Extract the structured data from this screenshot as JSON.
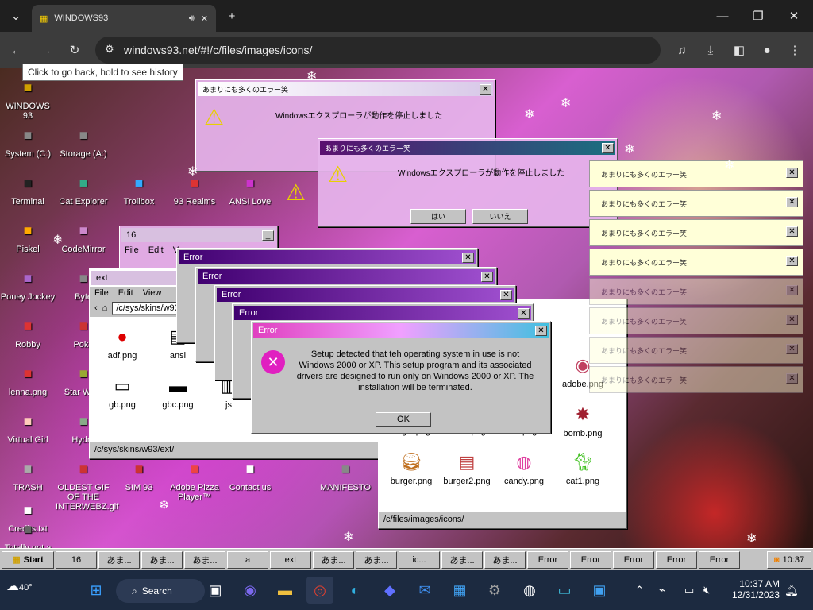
{
  "browser": {
    "tab_title": "WINDOWS93",
    "url": "windows93.net/#!/c/files/images/icons/",
    "tooltip": "Click to go back, hold to see history"
  },
  "desktop_icons": [
    {
      "label": "WINDOWS 93",
      "icon": "win93-icon"
    },
    {
      "label": "System (C:)",
      "icon": "drive-icon"
    },
    {
      "label": "Storage (A:)",
      "icon": "floppy-icon"
    },
    {
      "label": "Terminal",
      "icon": "terminal-icon"
    },
    {
      "label": "Cat Explorer",
      "icon": "cat-icon"
    },
    {
      "label": "Trollbox",
      "icon": "chat-icon"
    },
    {
      "label": "93 Realms",
      "icon": "realm-icon"
    },
    {
      "label": "ANSI Love",
      "icon": "ansi-icon"
    },
    {
      "label": "Piskel",
      "icon": "palette-icon"
    },
    {
      "label": "CodeMirror",
      "icon": "code-icon"
    },
    {
      "label": "Poney Jockey",
      "icon": "pony-icon"
    },
    {
      "label": "Byte",
      "icon": "byte-icon"
    },
    {
      "label": "Robby",
      "icon": "robot-icon"
    },
    {
      "label": "Poke",
      "icon": "poke-icon"
    },
    {
      "label": "lenna.png",
      "icon": "image-icon"
    },
    {
      "label": "Star Wars",
      "icon": "star-icon"
    },
    {
      "label": "Virtual Girl",
      "icon": "girl-icon"
    },
    {
      "label": "Hydra",
      "icon": "hydra-icon"
    },
    {
      "label": "TRASH",
      "icon": "trash-icon"
    },
    {
      "label": "OLDEST GIF OF THE INTERWEBZ.gif",
      "icon": "gif-icon"
    },
    {
      "label": "SIM 93",
      "icon": "sim-icon"
    },
    {
      "label": "Adobe Pizza Player™",
      "icon": "pizza-icon"
    },
    {
      "label": "Contact us",
      "icon": "mail-icon"
    },
    {
      "label": "MANIFESTO",
      "icon": "doc-icon"
    },
    {
      "label": "Credits.txt",
      "icon": "text-icon"
    },
    {
      "label": "Totally not a virus.Trust",
      "icon": "virus-icon"
    }
  ],
  "jp_dialog": {
    "title": "あまりにも多くのエラー笑",
    "message": "Windowsエクスプローラが動作を停止しました",
    "yes": "はい",
    "no": "いいえ"
  },
  "folder_16": {
    "title": "16",
    "menu": [
      "File",
      "Edit",
      "V"
    ]
  },
  "ext_window": {
    "title": "ext",
    "menu": [
      "File",
      "Edit",
      "View"
    ],
    "path": "/c/sys/skins/w93/ext/",
    "status": "/c/sys/skins/w93/ext/",
    "files": [
      {
        "name": "adf.png"
      },
      {
        "name": "ansi"
      },
      {
        "name": "gb.png"
      },
      {
        "name": "gbc.png"
      },
      {
        "name": "js"
      }
    ]
  },
  "icons_window": {
    "status": "/c/files/images/icons/",
    "files": [
      {
        "name": "adobe.png"
      },
      {
        "name": "bomb.png"
      },
      {
        "name": "angle.png"
      },
      {
        "name": "ankle.png"
      },
      {
        "name": "bat.png"
      },
      {
        "name": "burger.png"
      },
      {
        "name": "burger2.png"
      },
      {
        "name": "candy.png"
      },
      {
        "name": "cat1.png"
      }
    ]
  },
  "error_dialog": {
    "title": "Error",
    "message": "Setup detected that teh operating system in use is not Windows 2000 or XP. This setup program and its associated drivers are designed to run only on Windows 2000 or XP. The installation will be terminated.",
    "ok": "OK"
  },
  "notifications": [
    "あまりにも多くのエラー笑",
    "あまりにも多くのエラー笑",
    "あまりにも多くのエラー笑",
    "あまりにも多くのエラー笑",
    "あまりにも多くのエラー笑",
    "あまりにも多くのエラー笑",
    "あまりにも多くのエラー笑",
    "あまりにも多くのエラー笑"
  ],
  "taskbar93": {
    "start": "Start",
    "items": [
      "16",
      "あま...",
      "あま...",
      "あま...",
      "a",
      "ext",
      "あま...",
      "あま...",
      "ic...",
      "あま...",
      "あま...",
      "Error",
      "Error",
      "Error",
      "Error",
      "Error"
    ],
    "clock": "10:37"
  },
  "win_taskbar": {
    "weather": "40°",
    "search": "Search",
    "time": "10:37 AM",
    "date": "12/31/2023"
  }
}
